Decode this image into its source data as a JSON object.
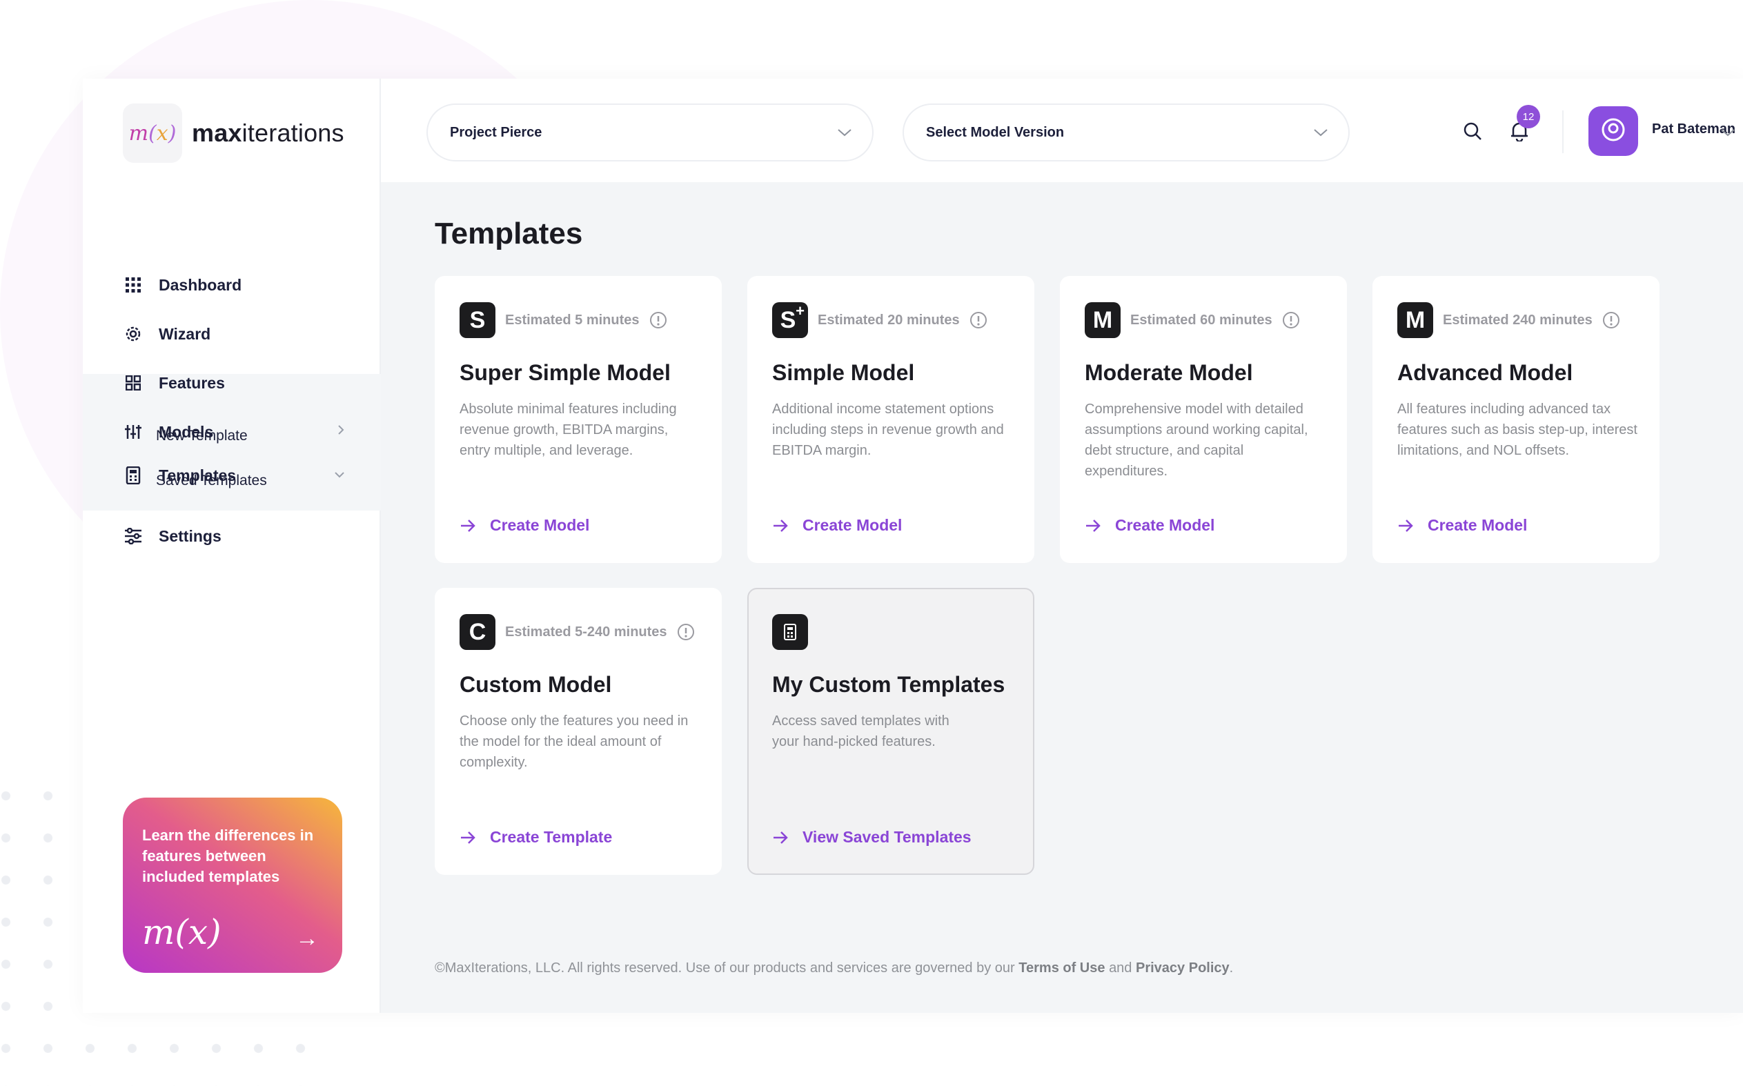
{
  "brand": {
    "logo_mark": "m(x)",
    "name_bold": "max",
    "name_regular": "iterations"
  },
  "sidebar": {
    "items": [
      {
        "label": "Dashboard",
        "icon": "grid-icon"
      },
      {
        "label": "Wizard",
        "icon": "gear-icon"
      },
      {
        "label": "Features",
        "icon": "blocks-icon"
      },
      {
        "label": "Models",
        "icon": "sliders-icon"
      },
      {
        "label": "Templates",
        "icon": "calculator-icon"
      },
      {
        "label": "Settings",
        "icon": "settings-sliders-icon"
      }
    ],
    "templates_sub": [
      "New Template",
      "Saved Templates"
    ],
    "promo": {
      "text": "Learn the differences in features between included templates",
      "logo": "m(x)",
      "arrow": "→"
    }
  },
  "topbar": {
    "project_select": "Project Pierce",
    "version_select": "Select Model Version",
    "notifications_count": "12",
    "user_name": "Pat Bateman"
  },
  "page": {
    "title": "Templates"
  },
  "cards": [
    {
      "letter": "S",
      "sup": "",
      "estimate": "Estimated 5 minutes",
      "title": "Super Simple Model",
      "desc": "Absolute minimal features including revenue growth, EBITDA margins, entry multiple, and leverage.",
      "link": "Create Model"
    },
    {
      "letter": "S",
      "sup": "+",
      "estimate": "Estimated 20 minutes",
      "title": "Simple Model",
      "desc": "Additional income statement options including steps in revenue growth and EBITDA margin.",
      "link": "Create Model"
    },
    {
      "letter": "M",
      "sup": "",
      "estimate": "Estimated 60 minutes",
      "title": "Moderate Model",
      "desc": "Comprehensive model with detailed assumptions around working capital, debt structure, and capital expenditures.",
      "link": "Create Model"
    },
    {
      "letter": "M",
      "sup": "",
      "estimate": "Estimated 240 minutes",
      "title": "Advanced Model",
      "desc": "All features including advanced tax features such as basis step-up, interest limitations, and NOL offsets.",
      "link": "Create Model"
    },
    {
      "letter": "C",
      "sup": "",
      "estimate": "Estimated 5-240 minutes",
      "title": "Custom Model",
      "desc": "Choose only the features you need in the model for the ideal amount of complexity.",
      "link": "Create Template"
    },
    {
      "letter": "",
      "sup": "",
      "estimate": "",
      "title": "My Custom Templates",
      "desc": "Access saved templates with your hand-picked features.",
      "link": "View Saved Templates"
    }
  ],
  "footer": {
    "text": "©MaxIterations, LLC. All rights reserved. Use of our products and services are governed by our",
    "terms": "Terms of Use",
    "and": "and",
    "privacy": "Privacy Policy",
    "end": "."
  },
  "colors": {
    "accent": "#8a45d6",
    "badge": "#8e4fd8",
    "avatar": "#8a4ee0"
  }
}
